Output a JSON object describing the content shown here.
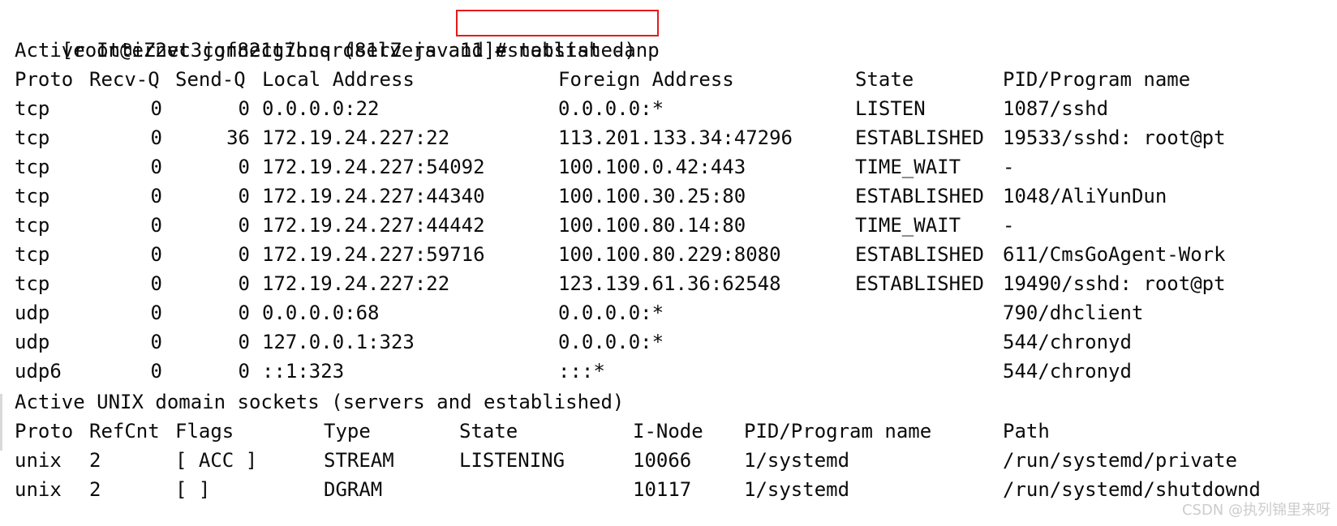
{
  "top_clip": "                                            ",
  "prompt": "[root@iZ2vc3jgf821g7hcqrd81lZ java11]# netstat -anp",
  "sections": {
    "inet_title": "Active Internet connections (servers and established)",
    "unix_title": "Active UNIX domain sockets (servers and established)"
  },
  "inet": {
    "headers": {
      "proto": "Proto",
      "recvq": "Recv-Q",
      "sendq": "Send-Q",
      "local": "Local Address",
      "foreign": "Foreign Address",
      "state": "State",
      "pid": "PID/Program name"
    },
    "rows": [
      {
        "proto": "tcp",
        "recvq": "0",
        "sendq": "0",
        "local": "0.0.0.0:22",
        "foreign": "0.0.0.0:*",
        "state": "LISTEN",
        "pid": "1087/sshd"
      },
      {
        "proto": "tcp",
        "recvq": "0",
        "sendq": "36",
        "local": "172.19.24.227:22",
        "foreign": "113.201.133.34:47296",
        "state": "ESTABLISHED",
        "pid": "19533/sshd: root@pt"
      },
      {
        "proto": "tcp",
        "recvq": "0",
        "sendq": "0",
        "local": "172.19.24.227:54092",
        "foreign": "100.100.0.42:443",
        "state": "TIME_WAIT",
        "pid": "-"
      },
      {
        "proto": "tcp",
        "recvq": "0",
        "sendq": "0",
        "local": "172.19.24.227:44340",
        "foreign": "100.100.30.25:80",
        "state": "ESTABLISHED",
        "pid": "1048/AliYunDun"
      },
      {
        "proto": "tcp",
        "recvq": "0",
        "sendq": "0",
        "local": "172.19.24.227:44442",
        "foreign": "100.100.80.14:80",
        "state": "TIME_WAIT",
        "pid": "-"
      },
      {
        "proto": "tcp",
        "recvq": "0",
        "sendq": "0",
        "local": "172.19.24.227:59716",
        "foreign": "100.100.80.229:8080",
        "state": "ESTABLISHED",
        "pid": "611/CmsGoAgent-Work"
      },
      {
        "proto": "tcp",
        "recvq": "0",
        "sendq": "0",
        "local": "172.19.24.227:22",
        "foreign": "123.139.61.36:62548",
        "state": "ESTABLISHED",
        "pid": "19490/sshd: root@pt"
      },
      {
        "proto": "udp",
        "recvq": "0",
        "sendq": "0",
        "local": "0.0.0.0:68",
        "foreign": "0.0.0.0:*",
        "state": "",
        "pid": "790/dhclient"
      },
      {
        "proto": "udp",
        "recvq": "0",
        "sendq": "0",
        "local": "127.0.0.1:323",
        "foreign": "0.0.0.0:*",
        "state": "",
        "pid": "544/chronyd"
      },
      {
        "proto": "udp6",
        "recvq": "0",
        "sendq": "0",
        "local": "::1:323",
        "foreign": ":::*",
        "state": "",
        "pid": "544/chronyd"
      }
    ]
  },
  "unix": {
    "headers": {
      "proto": "Proto",
      "refcnt": "RefCnt",
      "flags": "Flags",
      "type": "Type",
      "state": "State",
      "inode": "I-Node",
      "pid": "PID/Program name",
      "path": "Path"
    },
    "rows": [
      {
        "proto": "unix",
        "refcnt": "2",
        "flags": "[ ACC ]",
        "type": "STREAM",
        "state": "LISTENING",
        "inode": "10066",
        "pid": "1/systemd",
        "path": "/run/systemd/private"
      },
      {
        "proto": "unix",
        "refcnt": "2",
        "flags": "[ ]",
        "type": "DGRAM",
        "state": "",
        "inode": "10117",
        "pid": "1/systemd",
        "path": "/run/systemd/shutdownd"
      }
    ]
  },
  "watermark": "CSDN @执列锦里来呀",
  "colors": {
    "highlight_box": "#e41b1b",
    "text": "#0b0b0b",
    "background": "#ffffff"
  }
}
